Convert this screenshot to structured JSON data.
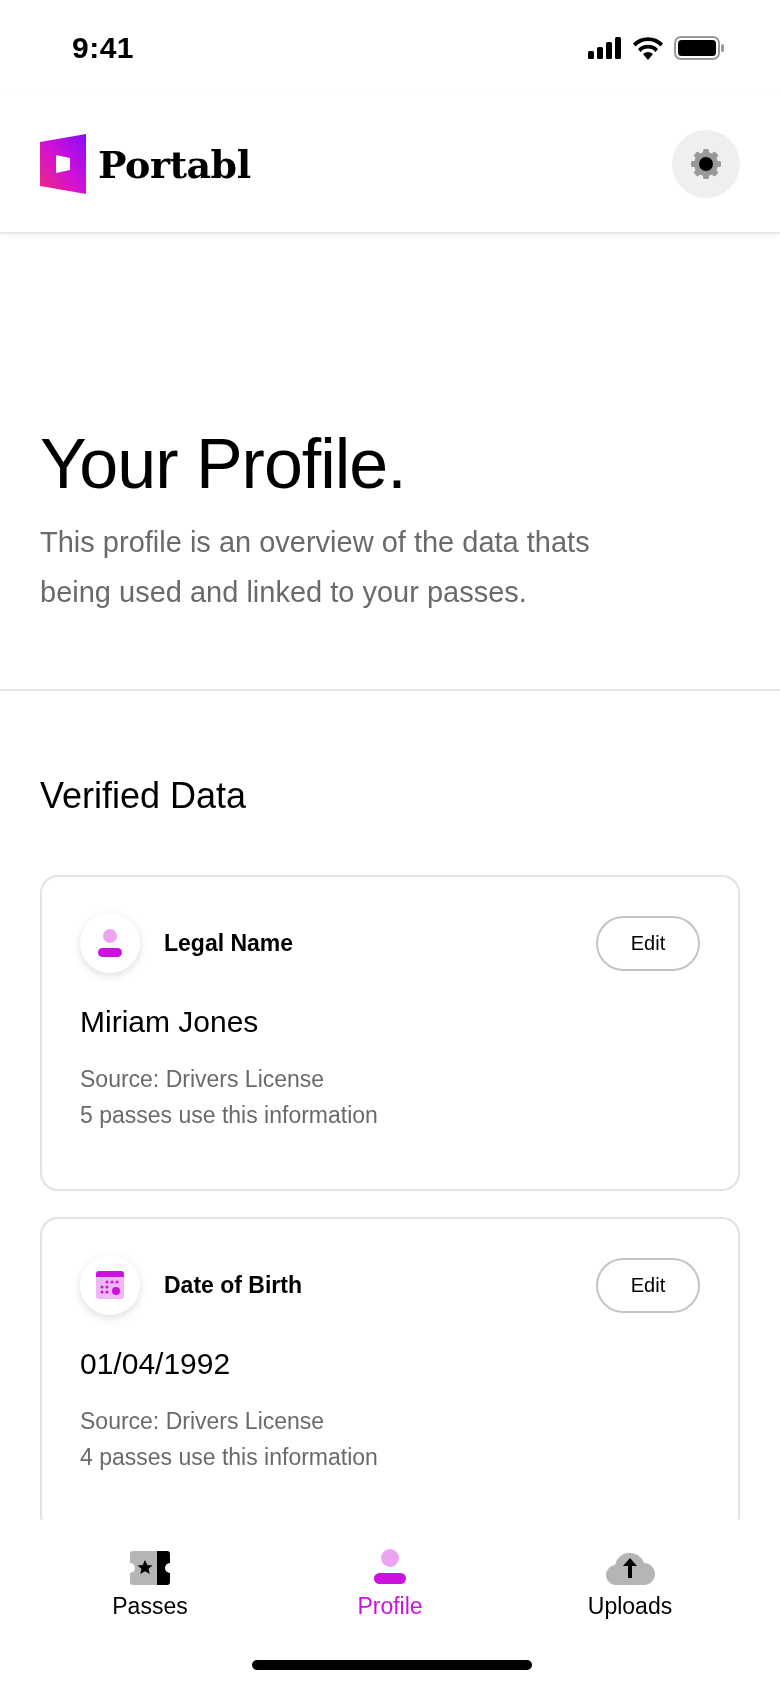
{
  "status_bar": {
    "time": "9:41"
  },
  "header": {
    "brand": "Portabl"
  },
  "hero": {
    "title": "Your Profile.",
    "description": "This profile is an overview of the data thats being used and linked to your passes."
  },
  "section": {
    "title": "Verified Data"
  },
  "cards": [
    {
      "kind": "person",
      "label": "Legal Name",
      "button": "Edit",
      "value": "Miriam Jones",
      "source": "Source: Drivers License",
      "usage": "5 passes use this information"
    },
    {
      "kind": "calendar",
      "label": "Date of Birth",
      "button": "Edit",
      "value": "01/04/1992",
      "source": "Source: Drivers License",
      "usage": "4 passes use this information"
    }
  ],
  "tabs": [
    {
      "kind": "ticket",
      "label": "Passes",
      "selected": false
    },
    {
      "kind": "person",
      "label": "Profile",
      "selected": true
    },
    {
      "kind": "cloud",
      "label": "Uploads",
      "selected": false
    }
  ]
}
